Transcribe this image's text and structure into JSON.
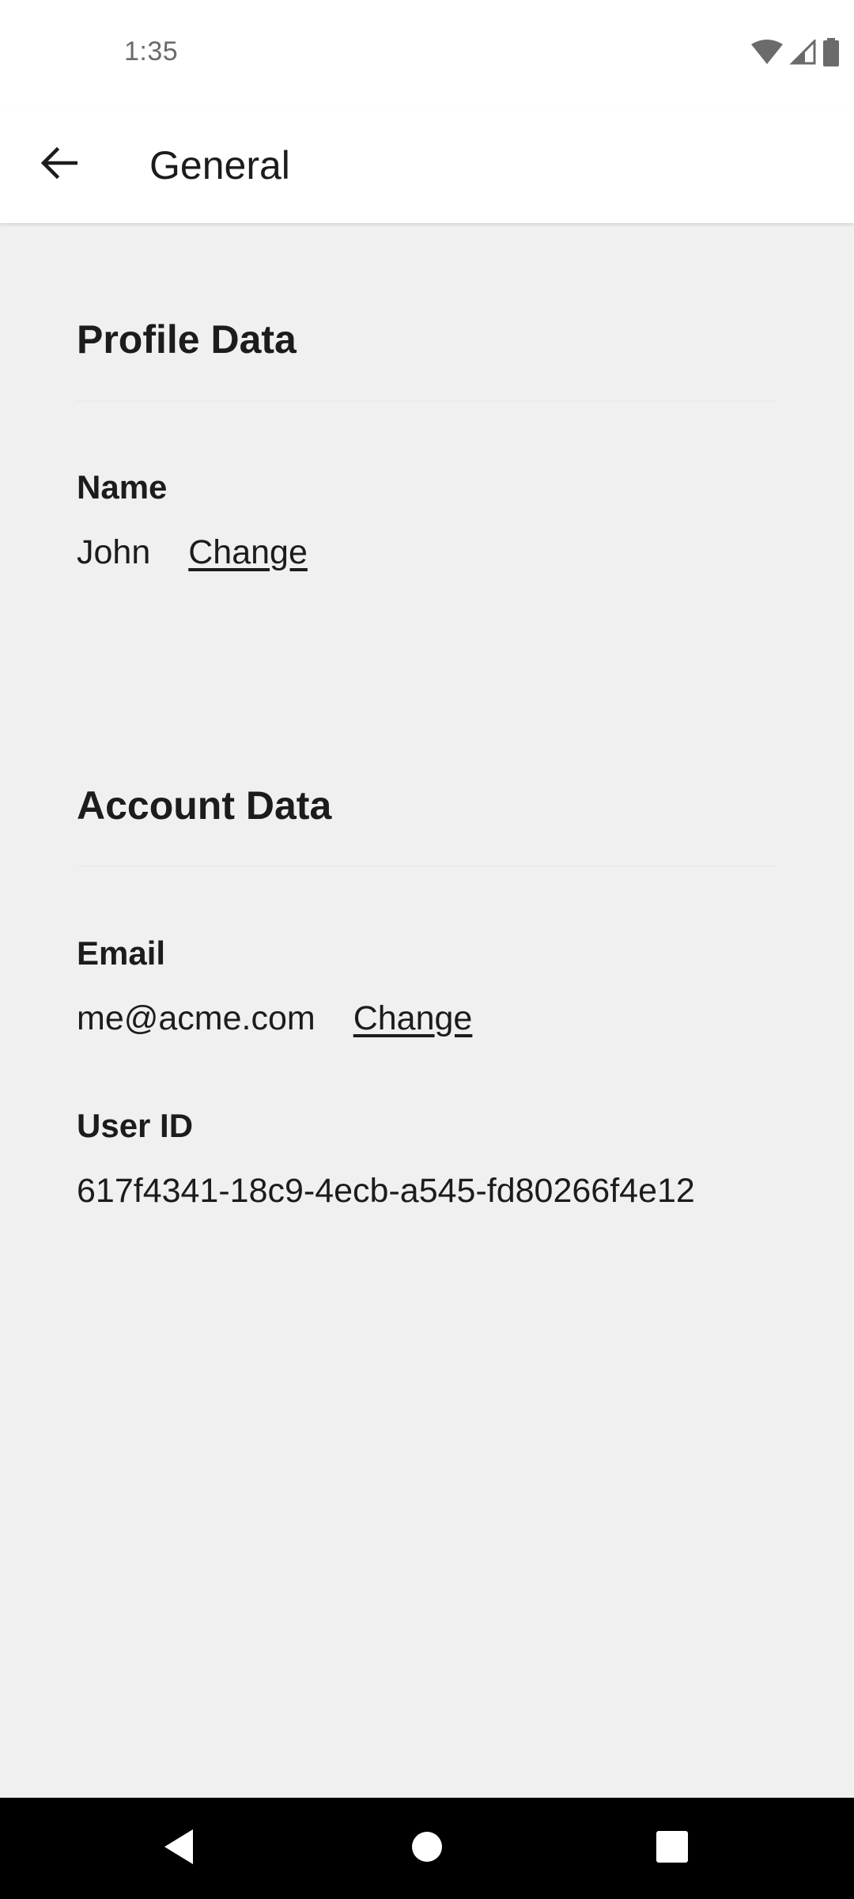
{
  "status_bar": {
    "time": "1:35",
    "icons": [
      "wifi-icon",
      "signal-icon",
      "battery-icon"
    ]
  },
  "app_bar": {
    "back_icon": "arrow-back-icon",
    "title": "General"
  },
  "profile_section": {
    "title": "Profile Data",
    "name_label": "Name",
    "name_value": "John",
    "name_change": "Change"
  },
  "account_section": {
    "title": "Account Data",
    "email_label": "Email",
    "email_value": "me@acme.com",
    "email_change": "Change",
    "user_id_label": "User ID",
    "user_id_value": "617f4341-18c9-4ecb-a545-fd80266f4e12"
  },
  "nav_bar": {
    "icons": [
      "nav-back-icon",
      "nav-home-icon",
      "nav-recents-icon"
    ]
  },
  "colors": {
    "background": "#f0f0f0",
    "surface": "#ffffff",
    "text": "#1c1c1c",
    "status_text": "#6b6b6b",
    "nav_bar": "#000000"
  }
}
